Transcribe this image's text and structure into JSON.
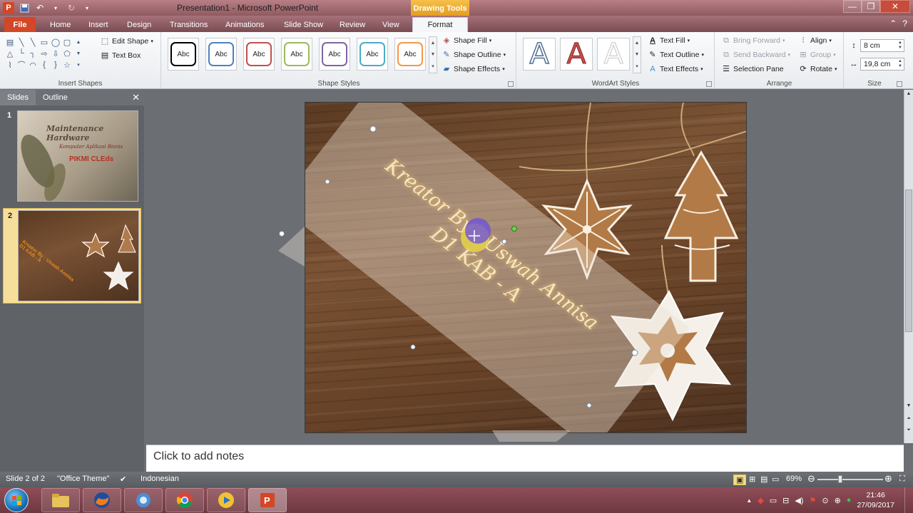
{
  "window": {
    "title": "Presentation1  -  Microsoft PowerPoint",
    "contextual_tab_group": "Drawing Tools"
  },
  "tabs": [
    "File",
    "Home",
    "Insert",
    "Design",
    "Transitions",
    "Animations",
    "Slide Show",
    "Review",
    "View",
    "Format"
  ],
  "active_tab": "Format",
  "ribbon": {
    "insert_shapes": {
      "label": "Insert Shapes",
      "edit_shape": "Edit Shape",
      "text_box": "Text Box"
    },
    "shape_styles": {
      "label": "Shape Styles",
      "samples": [
        "Abc",
        "Abc",
        "Abc",
        "Abc",
        "Abc",
        "Abc",
        "Abc"
      ],
      "sample_colors": [
        "#000000",
        "#4f81bd",
        "#c0504d",
        "#9bbb59",
        "#8064a2",
        "#4bacc6",
        "#f79646"
      ],
      "shape_fill": "Shape Fill",
      "shape_outline": "Shape Outline",
      "shape_effects": "Shape Effects"
    },
    "wordart_styles": {
      "label": "WordArt Styles",
      "samples": [
        "A",
        "A",
        "A"
      ],
      "text_fill": "Text Fill",
      "text_outline": "Text Outline",
      "text_effects": "Text Effects"
    },
    "arrange": {
      "label": "Arrange",
      "bring_forward": "Bring Forward",
      "send_backward": "Send Backward",
      "selection_pane": "Selection Pane",
      "align": "Align",
      "group": "Group",
      "rotate": "Rotate"
    },
    "size": {
      "label": "Size",
      "height": "8 cm",
      "width": "19,8 cm"
    }
  },
  "left_pane": {
    "tabs": [
      "Slides",
      "Outline"
    ],
    "slides": [
      {
        "number": "1",
        "title": "Maintenance Hardware",
        "subtitle": "Komputer Aplikasi Bisnis",
        "footer": "PIKMI CLEds"
      },
      {
        "number": "2",
        "caption": "Kreator By : Uswah Annisa\nD1 KAB - A"
      }
    ]
  },
  "slide": {
    "text_line1": "Kreator By : Uswah Annisa",
    "text_line2": "D1 KAB - A"
  },
  "notes_placeholder": "Click to add notes",
  "status_bar": {
    "slide_info": "Slide 2 of 2",
    "theme": "\"Office Theme\"",
    "language": "Indonesian",
    "zoom": "69%",
    "zoom_fraction": 0.69
  },
  "taskbar": {
    "time": "21:46",
    "date": "27/09/2017"
  }
}
